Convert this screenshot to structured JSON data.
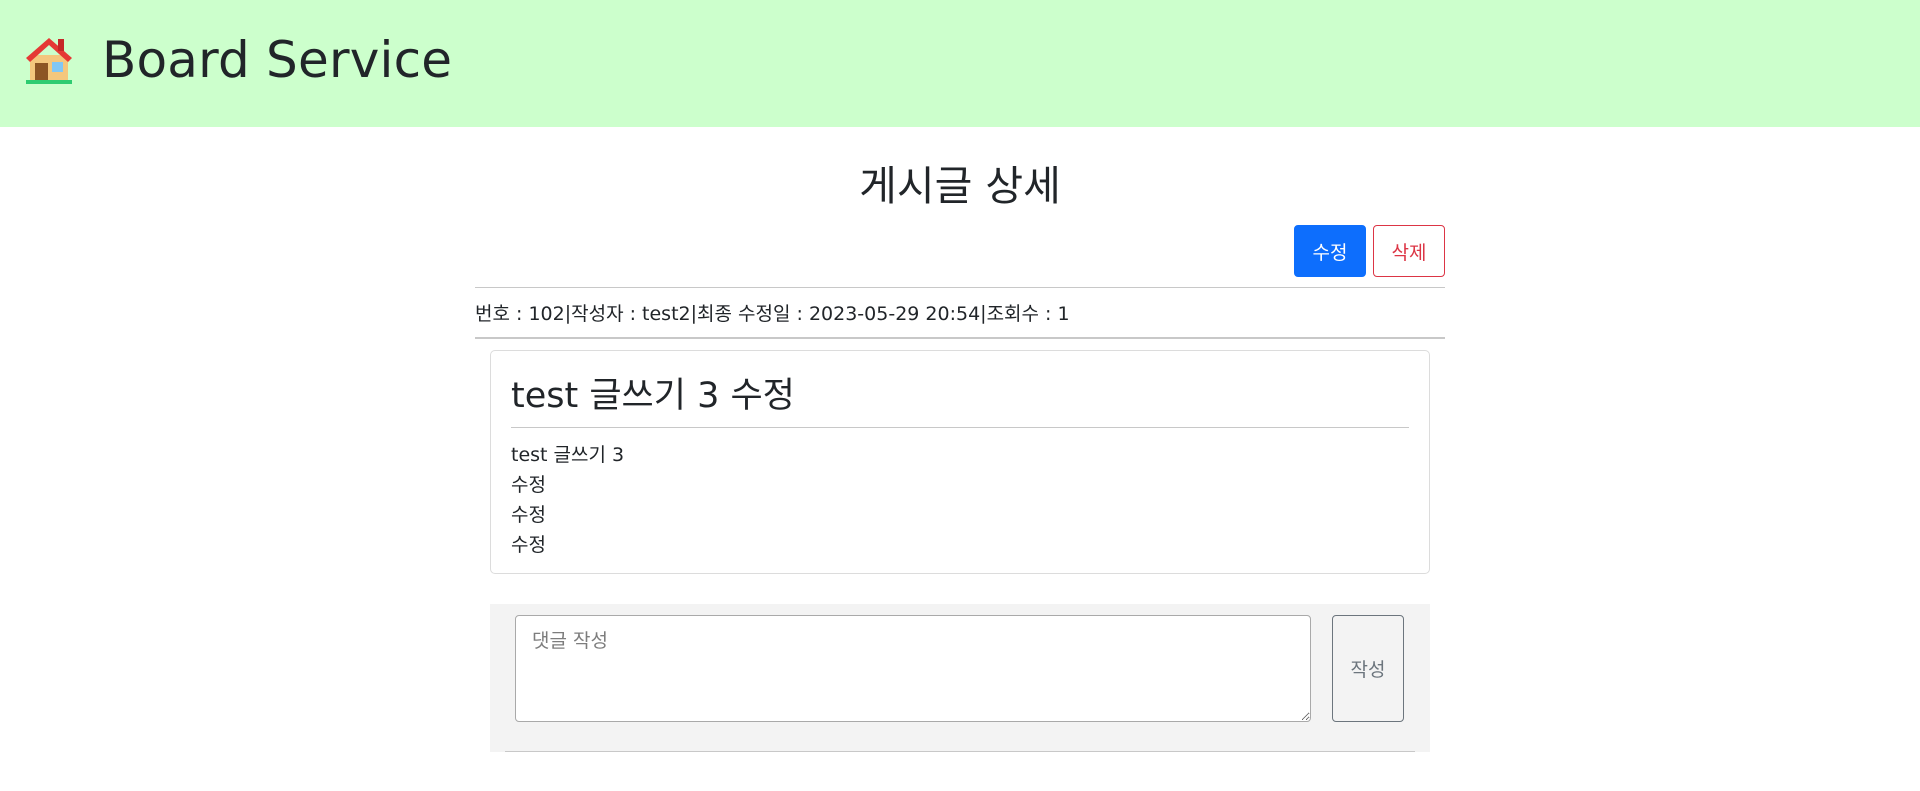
{
  "header": {
    "brand": "Board Service",
    "icon": "house-icon"
  },
  "page": {
    "title": "게시글 상세"
  },
  "actions": {
    "edit_label": "수정",
    "delete_label": "삭제"
  },
  "meta": {
    "number": "번호 : 102",
    "author": "작성자 : test2",
    "updated": "최종 수정일 : 2023-05-29 20:54",
    "views": "조회수 : 1",
    "separator": "|"
  },
  "post": {
    "title": "test 글쓰기 3 수정",
    "body": "test 글쓰기 3\n수정\n수정\n수정"
  },
  "comment": {
    "placeholder": "댓글 작성",
    "value": "",
    "submit_label": "작성"
  },
  "colors": {
    "header_bg": "#ccffcc",
    "primary": "#0d6efd",
    "danger": "#dc3545",
    "secondary": "#6c757d"
  }
}
